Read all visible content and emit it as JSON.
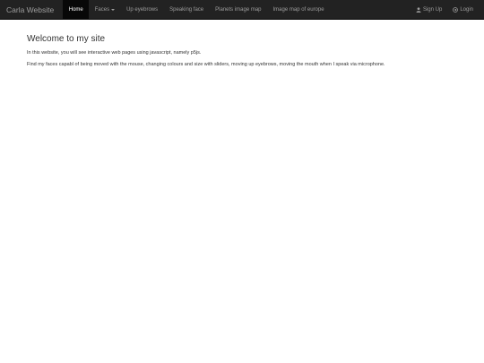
{
  "navbar": {
    "brand": "Carla Website",
    "items": [
      {
        "label": "Home",
        "active": true
      },
      {
        "label": "Faces",
        "dropdown": true
      },
      {
        "label": "Up eyebrows"
      },
      {
        "label": "Speaking face"
      },
      {
        "label": "Planets image map"
      },
      {
        "label": "Image map of europe"
      }
    ],
    "right": {
      "signup": {
        "label": "Sign Up",
        "icon": "user-icon"
      },
      "login": {
        "label": "Login",
        "icon": "login-icon"
      }
    }
  },
  "main": {
    "title": "Welcome to my site",
    "paragraphs": [
      "In this website, you will see interactive web pages using javascript, namely p5js.",
      "Find my faces capabl of being moved with the mouse, changing colours and size with sliders, moving up eyebrows, moving the mouth when I speak via microphone."
    ]
  },
  "colors": {
    "navbar_bg": "#222222",
    "active_bg": "#080808",
    "nav_text": "#9d9d9d",
    "body_text": "#333333"
  }
}
